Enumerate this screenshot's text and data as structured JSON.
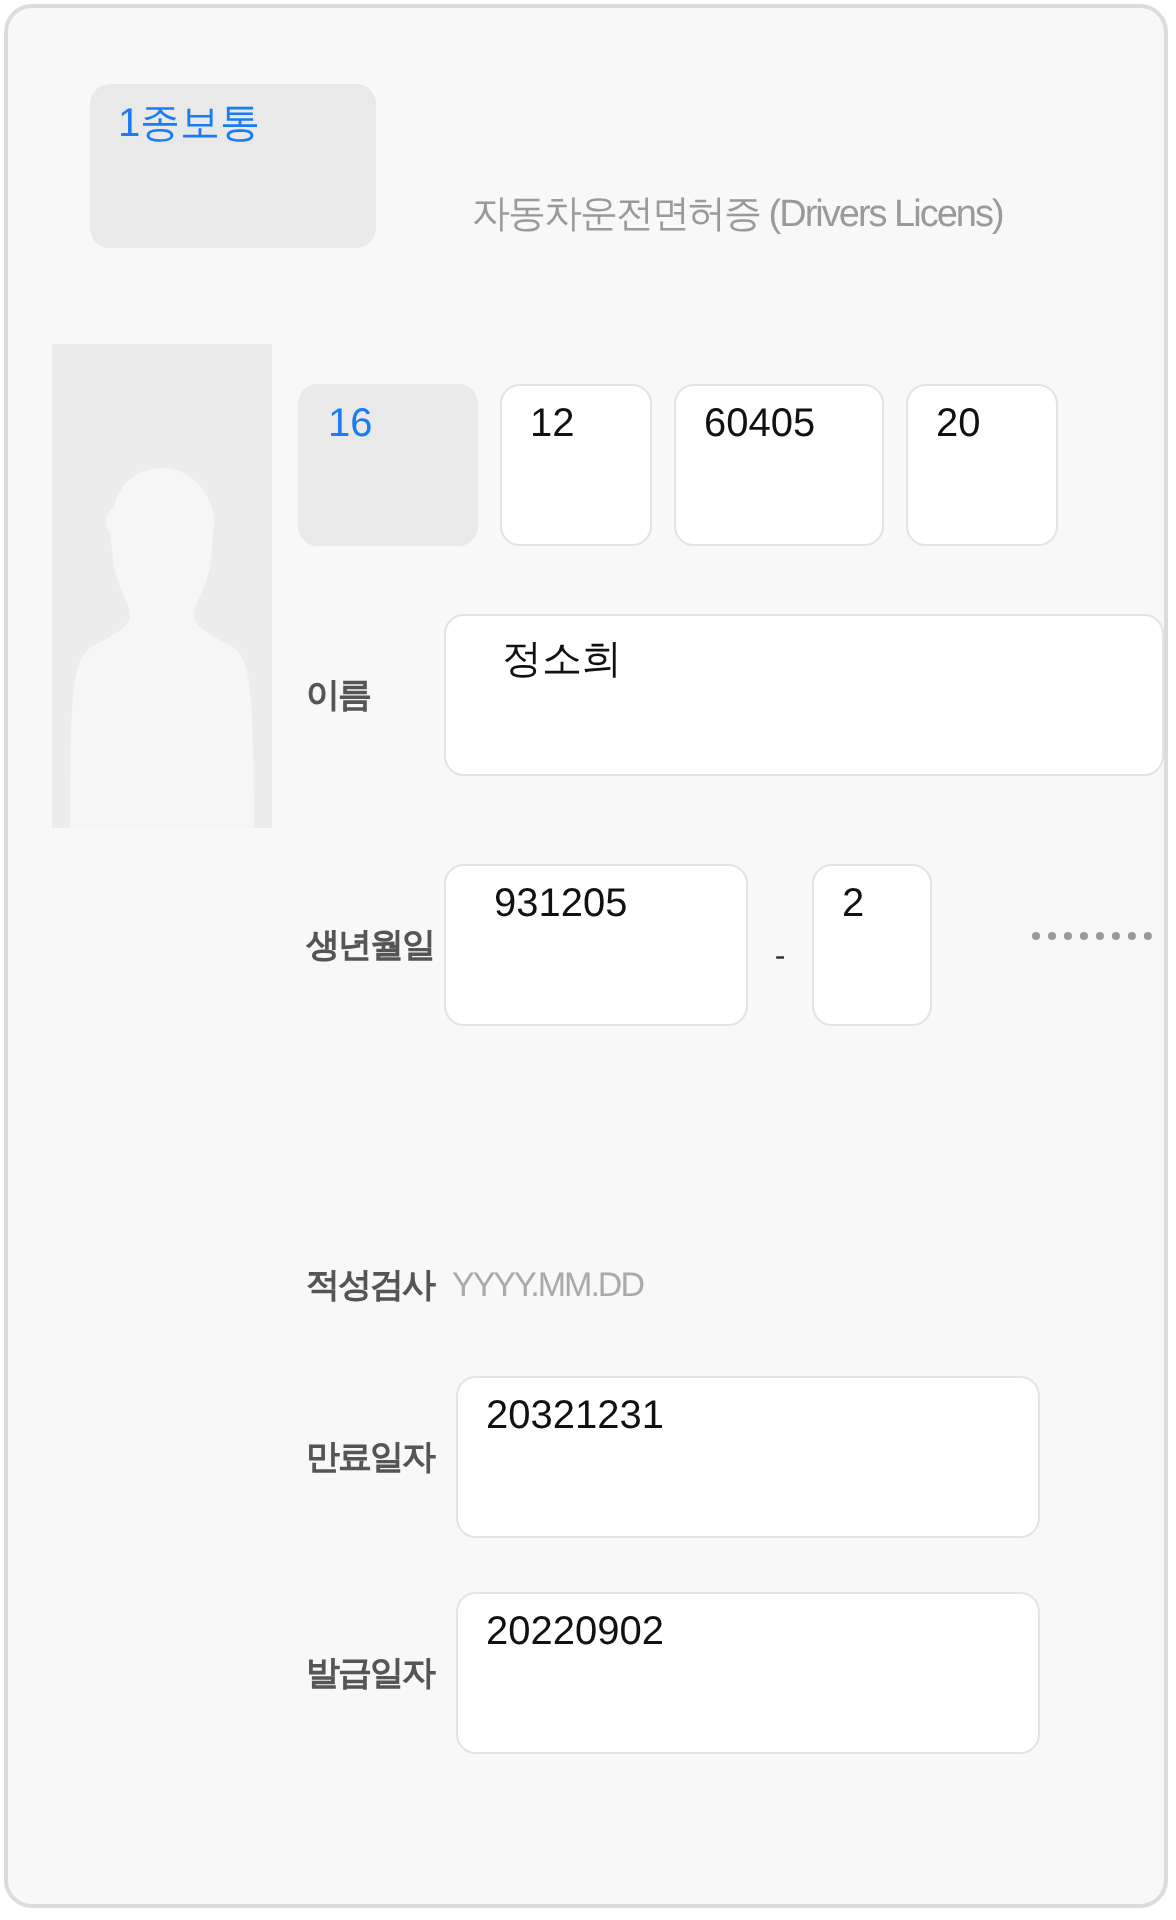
{
  "license_type": "1종보통",
  "title": "자동차운전면허증 (Drivers Licens)",
  "license_number": [
    {
      "value": "16",
      "editable": false
    },
    {
      "value": "12",
      "editable": true
    },
    {
      "value": "60405",
      "editable": true
    },
    {
      "value": "20",
      "editable": true
    }
  ],
  "name": {
    "label": "이름",
    "value": "정소희"
  },
  "birth": {
    "label": "생년월일",
    "front": "931205",
    "separator": "-",
    "back": "2"
  },
  "aptitude": {
    "label": "적성검사",
    "placeholder": "YYYY.MM.DD"
  },
  "expiry": {
    "label": "만료일자",
    "value": "20321231"
  },
  "issue": {
    "label": "발급일자",
    "value": "20220902"
  }
}
